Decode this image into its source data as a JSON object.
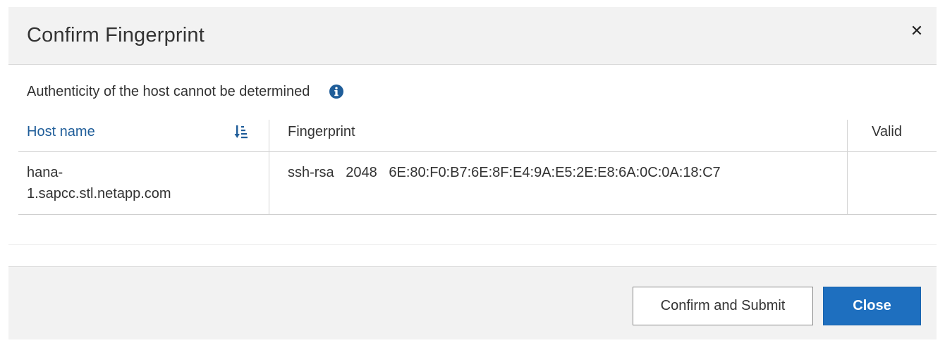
{
  "dialog": {
    "title": "Confirm Fingerprint",
    "close_icon": "close-icon"
  },
  "notice": {
    "text": "Authenticity of the host cannot be determined",
    "icon": "info-icon",
    "icon_color": "#1f5d99"
  },
  "table": {
    "columns": [
      "Host name",
      "Fingerprint",
      "Valid"
    ],
    "sort_icon": "sort-ascending-icon",
    "rows": [
      {
        "host_line1": "hana-",
        "host_line2": "1.sapcc.stl.netapp.com",
        "fingerprint": "ssh-rsa   2048   6E:80:F0:B7:6E:8F:E4:9A:E5:2E:E8:6A:0C:0A:18:C7",
        "valid": ""
      }
    ]
  },
  "footer": {
    "confirm_label": "Confirm and Submit",
    "close_label": "Close"
  },
  "colors": {
    "accent": "#1e6fbf",
    "link": "#1f5d99",
    "header_bg": "#f2f2f2"
  }
}
